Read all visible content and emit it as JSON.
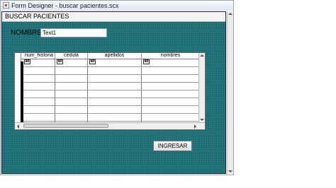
{
  "window": {
    "title": "Form Designer - buscar pacientes.scx"
  },
  "form": {
    "caption": "BUSCAR PACIENTES",
    "nombre_label": "NOMBRE",
    "text_value": "Text1",
    "button_label": "INGRESAR"
  },
  "grid": {
    "columns": [
      "num_historia",
      "cedula",
      "apellidos",
      "nombres"
    ],
    "textbox_icon": "ab",
    "row_count": 8
  },
  "colors": {
    "form_background": "#1e6e74",
    "selection_bar": "#000000"
  },
  "icons": [
    "app-icon",
    "textbox-icon",
    "scroll-arrow-icons"
  ]
}
